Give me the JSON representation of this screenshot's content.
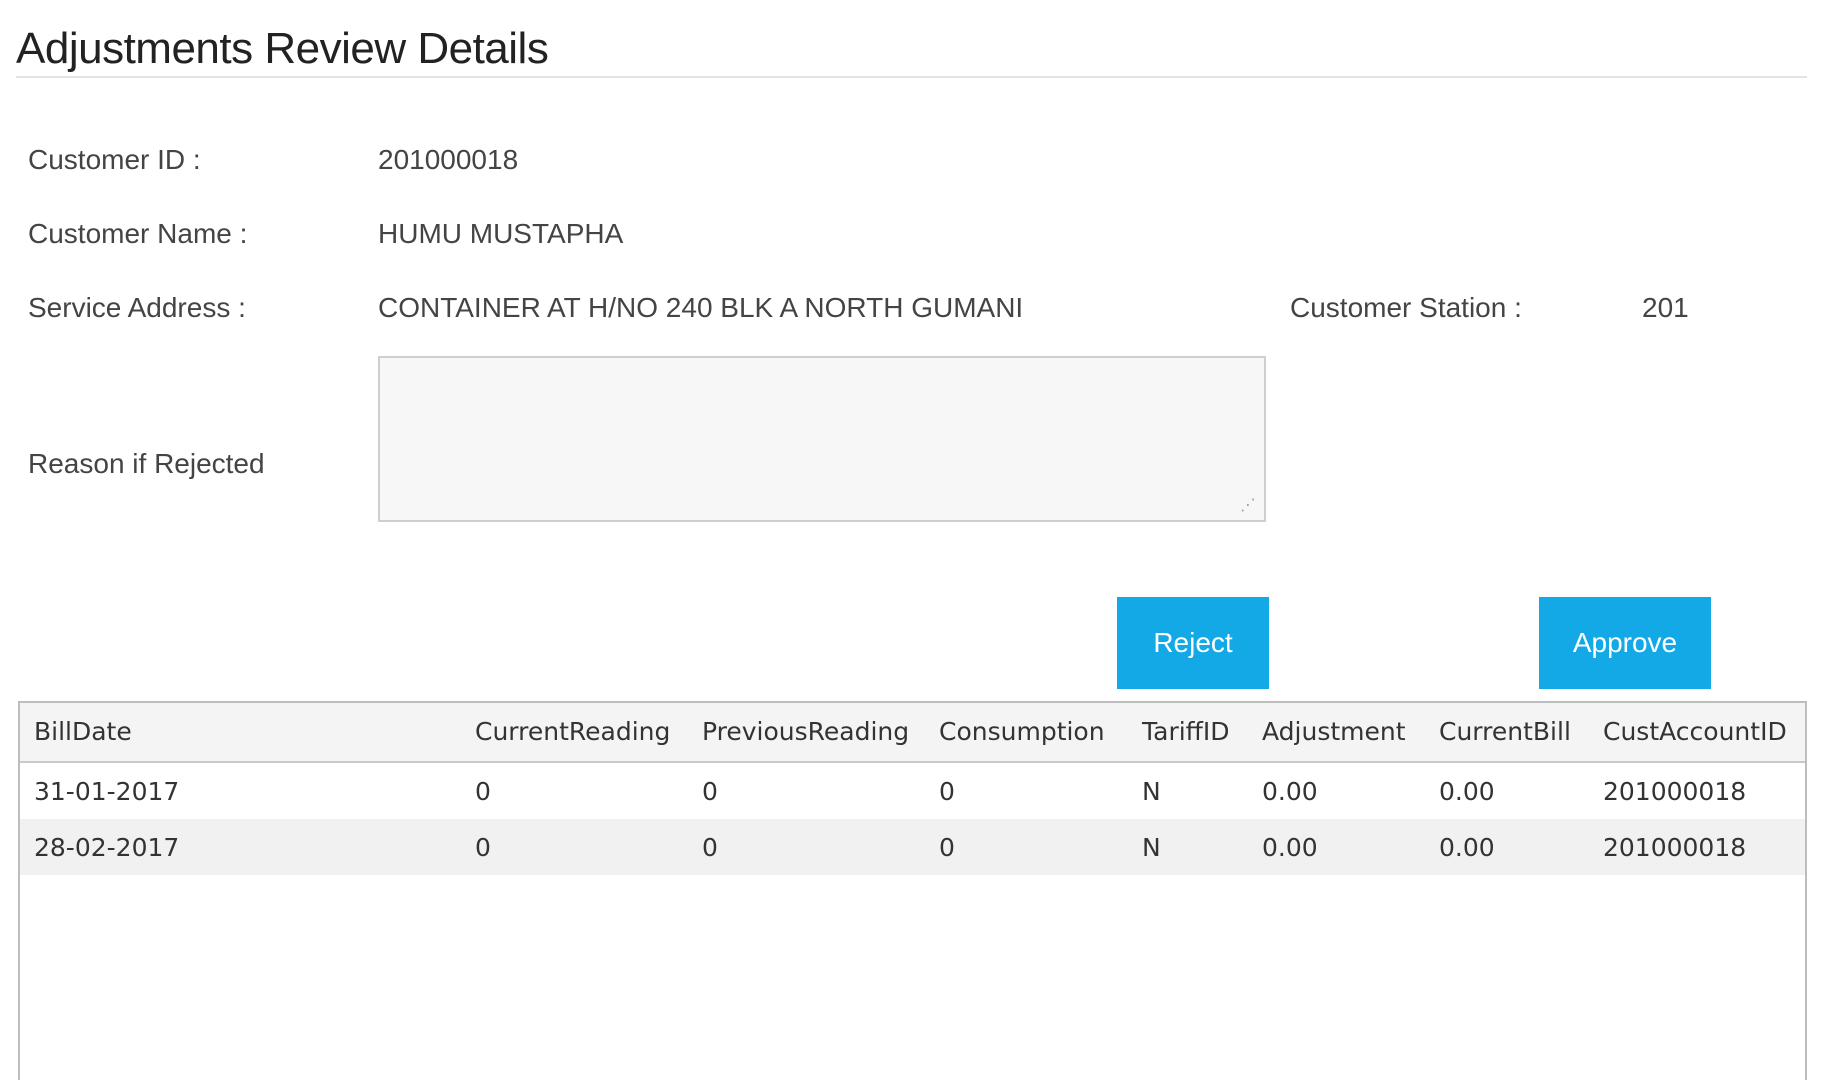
{
  "page": {
    "title": "Adjustments Review Details"
  },
  "details": {
    "customer_id_label": "Customer ID :",
    "customer_id_value": "201000018",
    "customer_name_label": "Customer Name :",
    "customer_name_value": "HUMU MUSTAPHA",
    "service_address_label": "Service Address :",
    "service_address_value": "CONTAINER AT H/NO 240 BLK A NORTH GUMANI",
    "customer_station_label": "Customer Station :",
    "customer_station_value": "201",
    "reason_label": "Reason if Rejected",
    "reason_value": ""
  },
  "actions": {
    "reject_label": "Reject",
    "approve_label": "Approve"
  },
  "colors": {
    "button_bg": "#13a9e6",
    "button_text": "#ffffff"
  },
  "table": {
    "columns": [
      "BillDate",
      "CurrentReading",
      "PreviousReading",
      "Consumption",
      "TariffID",
      "Adjustment",
      "CurrentBill",
      "CustAccountID"
    ],
    "rows": [
      [
        "31-01-2017",
        "0",
        "0",
        "0",
        "N",
        "0.00",
        "0.00",
        "201000018"
      ],
      [
        "28-02-2017",
        "0",
        "0",
        "0",
        "N",
        "0.00",
        "0.00",
        "201000018"
      ]
    ]
  }
}
